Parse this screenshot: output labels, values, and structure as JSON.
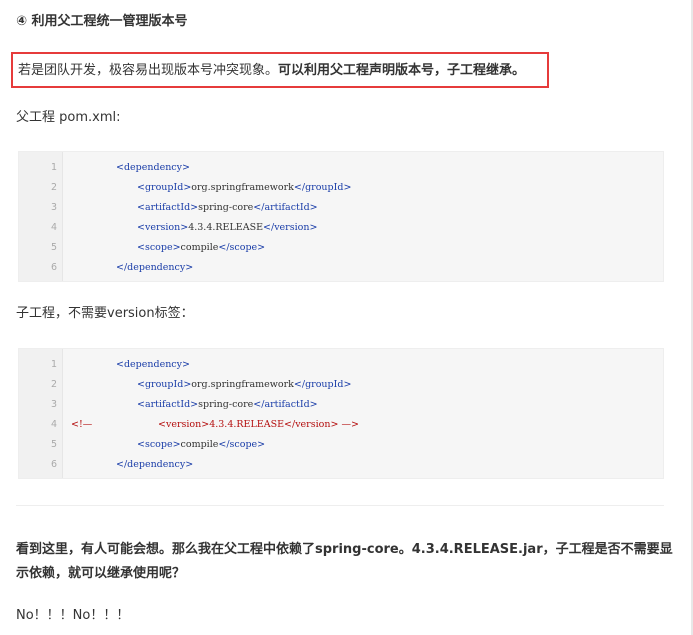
{
  "heading": "④ 利用父工程统一管理版本号",
  "highlight": {
    "normal": "若是团队开发，极容易出现版本号冲突现象。",
    "bold": "可以利用父工程声明版本号，子工程继承。"
  },
  "parent_label": "父工程 pom.xml:",
  "parent_code": [
    {
      "num": "1",
      "indent": 0,
      "parts": [
        {
          "t": "<dependency>",
          "c": "tag"
        }
      ]
    },
    {
      "num": "2",
      "indent": 1,
      "parts": [
        {
          "t": "<groupId>",
          "c": "tag"
        },
        {
          "t": "org.springframework",
          "c": "txt"
        },
        {
          "t": "</groupId>",
          "c": "tag"
        }
      ]
    },
    {
      "num": "3",
      "indent": 1,
      "parts": [
        {
          "t": "<artifactId>",
          "c": "tag"
        },
        {
          "t": "spring-core",
          "c": "txt"
        },
        {
          "t": "</artifactId>",
          "c": "tag"
        }
      ]
    },
    {
      "num": "4",
      "indent": 1,
      "parts": [
        {
          "t": "<version>",
          "c": "tag"
        },
        {
          "t": "4.3.4.RELEASE",
          "c": "txt"
        },
        {
          "t": "</version>",
          "c": "tag"
        }
      ]
    },
    {
      "num": "5",
      "indent": 1,
      "parts": [
        {
          "t": "<scope>",
          "c": "tag"
        },
        {
          "t": "compile",
          "c": "txt"
        },
        {
          "t": "</scope>",
          "c": "tag"
        }
      ]
    },
    {
      "num": "6",
      "indent": 0,
      "parts": [
        {
          "t": "</dependency>",
          "c": "tag"
        }
      ]
    }
  ],
  "child_label": "子工程，不需要version标签：",
  "child_code": [
    {
      "num": "1",
      "indent": 0,
      "parts": [
        {
          "t": "<dependency>",
          "c": "tag"
        }
      ]
    },
    {
      "num": "2",
      "indent": 1,
      "parts": [
        {
          "t": "<groupId>",
          "c": "tag"
        },
        {
          "t": "org.springframework",
          "c": "txt"
        },
        {
          "t": "</groupId>",
          "c": "tag"
        }
      ]
    },
    {
      "num": "3",
      "indent": 1,
      "parts": [
        {
          "t": "<artifactId>",
          "c": "tag"
        },
        {
          "t": "spring-core",
          "c": "txt"
        },
        {
          "t": "</artifactId>",
          "c": "tag"
        }
      ]
    },
    {
      "num": "4",
      "indent": 2,
      "prefix": "<!—",
      "parts": [
        {
          "t": "<version>4.3.4.RELEASE</version> —>",
          "c": "red"
        }
      ]
    },
    {
      "num": "5",
      "indent": 1,
      "parts": [
        {
          "t": "<scope>",
          "c": "tag"
        },
        {
          "t": "compile",
          "c": "txt"
        },
        {
          "t": "</scope>",
          "c": "tag"
        }
      ]
    },
    {
      "num": "6",
      "indent": 0,
      "parts": [
        {
          "t": "</dependency>",
          "c": "tag"
        }
      ]
    }
  ],
  "question": "看到这里，有人可能会想。那么我在父工程中依赖了spring-core。4.3.4.RELEASE.jar，子工程是否不需要显示依赖，就可以继承使用呢？",
  "no_line": "No！！！No！！！",
  "colors": {
    "highlight_border": "#e63b3b",
    "tag": "#1a3da8",
    "comment": "#b40f0f",
    "code_bg": "#f6f6f6"
  }
}
